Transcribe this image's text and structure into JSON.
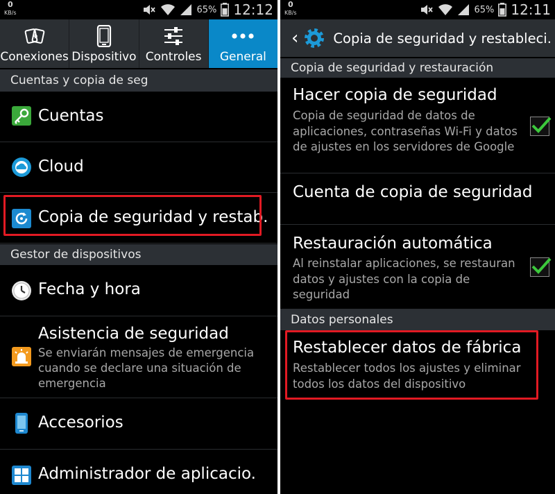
{
  "left": {
    "statusbar": {
      "speed": "0",
      "speed_unit": "KB/s",
      "battery": "65%",
      "time": "12:12"
    },
    "tabs": [
      {
        "label": "Conexiones",
        "icon": "connections-icon"
      },
      {
        "label": "Dispositivo",
        "icon": "device-icon"
      },
      {
        "label": "Controles",
        "icon": "controls-icon"
      },
      {
        "label": "General",
        "icon": "more-dots-icon",
        "active": true
      }
    ],
    "sections": [
      {
        "header": "Cuentas y copia de seg"
      },
      {
        "header": "Gestor de dispositivos"
      }
    ],
    "items": {
      "cuentas": {
        "title": "Cuentas",
        "icon": "key-icon"
      },
      "cloud": {
        "title": "Cloud",
        "icon": "cloud-icon"
      },
      "copia": {
        "title": "Copia de seguridad y restab.",
        "icon": "backup-restore-icon"
      },
      "fecha": {
        "title": "Fecha y hora",
        "icon": "clock-icon"
      },
      "asistencia": {
        "title": "Asistencia de seguridad",
        "subtitle": "Se enviarán mensajes de emergencia cuando se declare una situación de emergencia",
        "icon": "emergency-siren-icon"
      },
      "accesorios": {
        "title": "Accesorios",
        "icon": "accessories-icon"
      },
      "administrador": {
        "title": "Administrador de aplicacio.",
        "icon": "app-grid-icon"
      }
    }
  },
  "right": {
    "statusbar": {
      "speed": "0",
      "speed_unit": "KB/s",
      "battery": "65%",
      "time": "12:11"
    },
    "actionbar": {
      "title": "Copia de seguridad y restableci."
    },
    "sections": [
      {
        "header": "Copia de seguridad y restauración"
      },
      {
        "header": "Datos personales"
      }
    ],
    "items": {
      "hacer": {
        "title": "Hacer copia de seguridad",
        "subtitle": "Copia de seguridad de datos de aplicaciones, contraseñas Wi-Fi y datos de ajustes en los servidores de Google",
        "checked": true
      },
      "cuenta": {
        "title": "Cuenta de copia de seguridad"
      },
      "restauracion": {
        "title": "Restauración automática",
        "subtitle": "Al reinstalar aplicaciones, se restauran datos y ajustes con la copia de seguridad",
        "checked": true
      },
      "restablecer": {
        "title": "Restablecer datos de fábrica",
        "subtitle": "Restablecer todos los ajustes y eliminar todos los datos del dispositivo"
      }
    }
  },
  "colors": {
    "accent": "#0a88c8",
    "highlight_box": "#e21a23",
    "check": "#3cc83c",
    "header_bg": "#2c3035"
  }
}
